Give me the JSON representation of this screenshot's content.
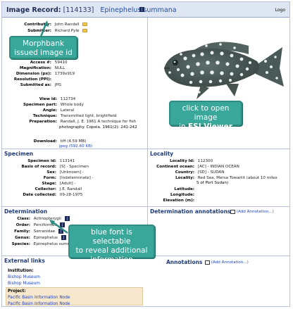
{
  "header": {
    "label": "Image Record:",
    "record_id": "[114133]",
    "scientific_name": "Epinephelus summana",
    "logo_text": "Logo"
  },
  "image_details": {
    "contributor_label": "Contributor:",
    "contributor_value": "John Randall",
    "submitter_label": "Submitter:",
    "submitter_value": "Richard Pyle",
    "access_label": "Access #:",
    "access_value": "59410",
    "magnification_label": "Magnification:",
    "magnification_value": "NULL",
    "dimension_label": "Dimension (px):",
    "dimension_value": "1739x919",
    "resolution_label": "Resolution (PPI):",
    "resolution_value": "",
    "submitted_as_label": "Submitted as:",
    "submitted_as_value": "JPG",
    "view_id_label": "View id:",
    "view_id_value": "112734",
    "specimen_part_label": "Specimen part:",
    "specimen_part_value": "Whole body",
    "angle_label": "Angle:",
    "angle_value": "Lateral",
    "technique_label": "Technique:",
    "technique_value": "Transmitted light, brightfield",
    "preparation_label": "Preparation:",
    "preparation_line1": "Randall, J. E. 1961 A technique for fish",
    "preparation_line2": "photography. Copeia. 1961(2): 241-242",
    "download_label": "Download:",
    "download_tiff": "tiff (4.59 MB)",
    "download_jpeg": "jpeg (592.60 KB)"
  },
  "specimen": {
    "title": "Specimen",
    "rows": [
      {
        "k": "Specimen id:",
        "v": "113141",
        "link": true
      },
      {
        "k": "Basis of record:",
        "v": "[S] - Specimen",
        "link": false
      },
      {
        "k": "Sex:",
        "v": "[Unknown] -",
        "link": false
      },
      {
        "k": "Form:",
        "v": "[Indeterminate] -",
        "link": false
      },
      {
        "k": "Stage:",
        "v": "[Adult] -",
        "link": false
      },
      {
        "k": "Collector:",
        "v": "J.E. Randall",
        "link": false
      },
      {
        "k": "Date collected:",
        "v": "09-28-1975",
        "link": false
      }
    ]
  },
  "locality": {
    "title": "Locality",
    "rows": [
      {
        "k": "Locality Id:",
        "v": "112300",
        "link": true
      },
      {
        "k": "Continent ocean:",
        "v": "[AC] - INDIAN OCEAN",
        "link": false
      },
      {
        "k": "Country:",
        "v": "[SD] - SUDAN",
        "link": false
      },
      {
        "k": "Locality:",
        "v": "Red Sea, Mersa Towartit (about 10 miles",
        "link": false
      },
      {
        "k": "",
        "v": "S of Port Sudan)",
        "link": false
      },
      {
        "k": "Latitude:",
        "v": "",
        "link": false
      },
      {
        "k": "Longitude:",
        "v": "",
        "link": false
      },
      {
        "k": "Elevation (m):",
        "v": "",
        "link": false
      }
    ]
  },
  "determination": {
    "title": "Determination",
    "rows": [
      {
        "k": "Class:",
        "v": "Actinopterygii"
      },
      {
        "k": "Order:",
        "v": "Perciformes"
      },
      {
        "k": "Family:",
        "v": "Serranidae"
      },
      {
        "k": "Genus:",
        "v": "Epinephelus"
      },
      {
        "k": "Species:",
        "v": "Epinephelus summana"
      }
    ]
  },
  "determination_annotations": {
    "title": "Determination annotations",
    "add_label": "(Add Annotation...)"
  },
  "external_links": {
    "title": "External links",
    "institution_label": "Institution:",
    "institution_link1": "Bishop Museum",
    "institution_link2": "Bishop Museum",
    "project_label": "Project:",
    "project_link1": "Pacific Basin Information Node",
    "project_link2": "Pacific Basin Information Node"
  },
  "annotations": {
    "title": "Annotations",
    "add_label": "(Add Annotation...)"
  },
  "callouts": {
    "morphbank": "Morphbank issued image id",
    "fsi_line1": "click to open image",
    "fsi_prefix": "in ",
    "fsi_bold": "FSI Viewer",
    "blue_font_line1": "blue font is selectable",
    "blue_font_line2": "to reveal additional",
    "blue_font_line3": "information"
  },
  "colors": {
    "link": "#1a43c8",
    "callout_bg": "#3aa79b",
    "header_bg": "#dfe6f3",
    "section_title": "#1f3a7a"
  }
}
